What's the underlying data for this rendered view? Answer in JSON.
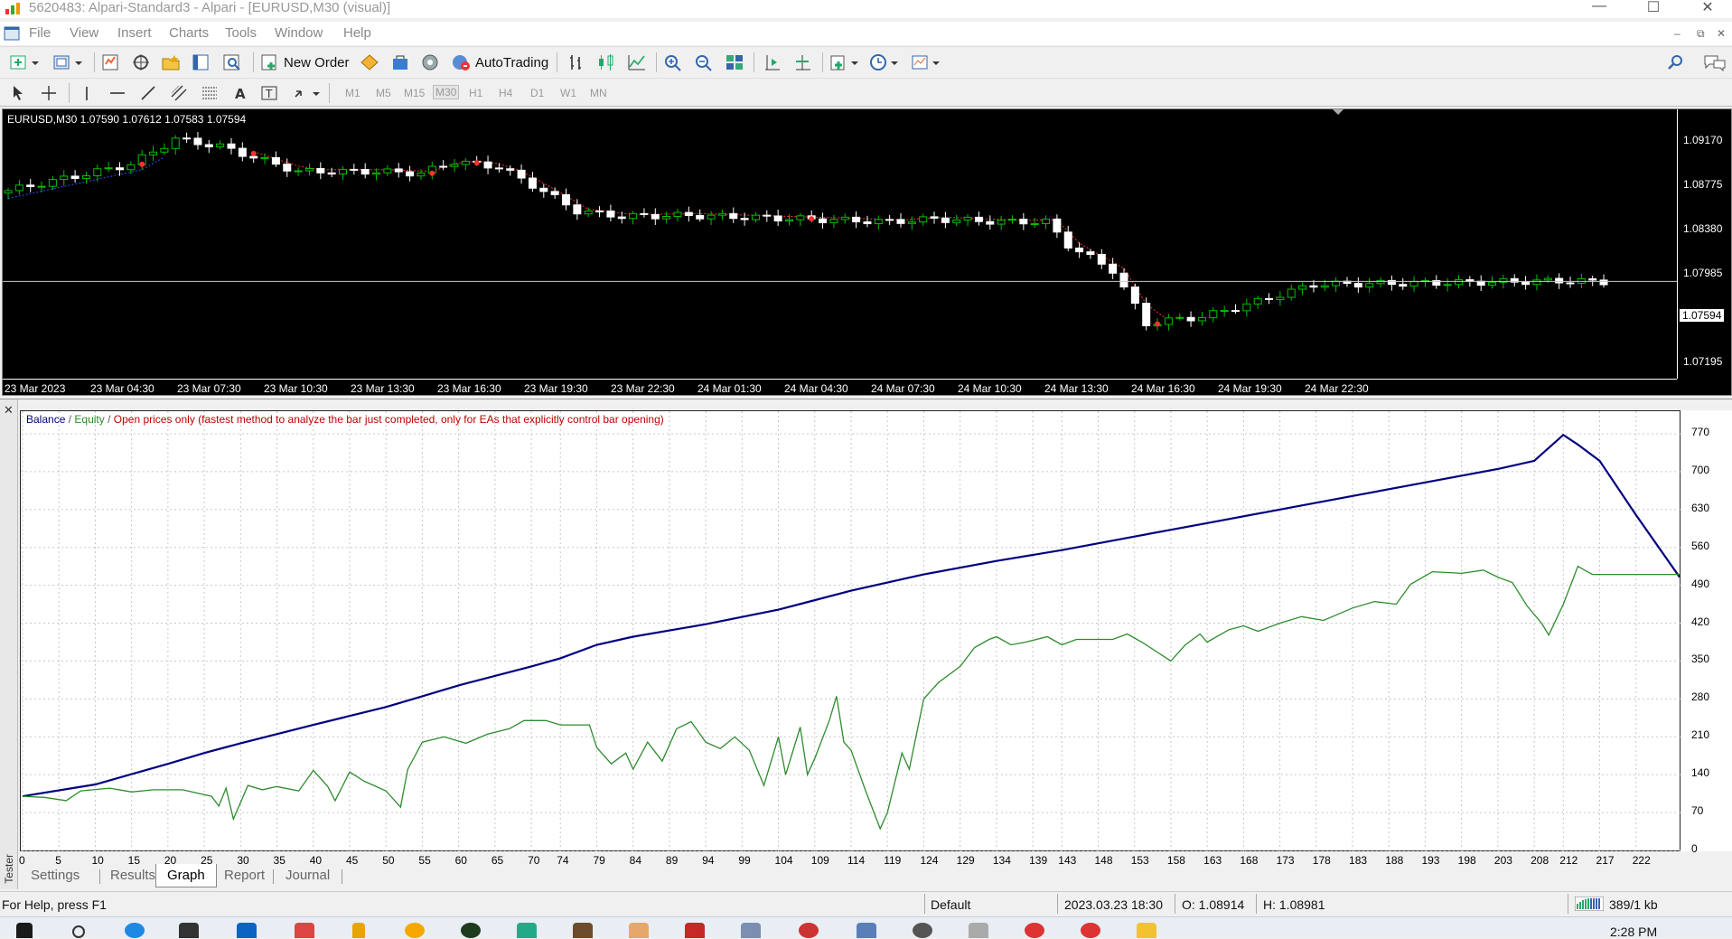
{
  "window": {
    "title": "5620483: Alpari-Standard3 - Alpari - [EURUSD,M30 (visual)]",
    "min": "—",
    "max": "☐",
    "close": "✕"
  },
  "menu": {
    "items": [
      "File",
      "View",
      "Insert",
      "Charts",
      "Tools",
      "Window",
      "Help"
    ],
    "mdi": [
      "–",
      "⧉",
      "✕"
    ]
  },
  "toolbar": {
    "new_order": "New Order",
    "autotrading": "AutoTrading"
  },
  "timeframes": [
    "M1",
    "M5",
    "M15",
    "M30",
    "H1",
    "H4",
    "D1",
    "W1",
    "MN"
  ],
  "active_timeframe": "M30",
  "chart": {
    "symbol_label": "EURUSD,M30  1.07590 1.07612 1.07583 1.07594",
    "prices": [
      "1.09170",
      "1.08775",
      "1.08380",
      "1.07985",
      "1.07195"
    ],
    "current_price": "1.07594",
    "times": [
      "23 Mar 2023",
      "23 Mar 04:30",
      "23 Mar 07:30",
      "23 Mar 10:30",
      "23 Mar 13:30",
      "23 Mar 16:30",
      "23 Mar 19:30",
      "23 Mar 22:30",
      "24 Mar 01:30",
      "24 Mar 04:30",
      "24 Mar 07:30",
      "24 Mar 10:30",
      "24 Mar 13:30",
      "24 Mar 16:30",
      "24 Mar 19:30",
      "24 Mar 22:30"
    ],
    "colors": {
      "bull": "#00c000",
      "bear": "#ffffff",
      "background": "#000000"
    }
  },
  "tester": {
    "side_label": "Tester",
    "legend": {
      "balance": "Balance",
      "equity": "Equity",
      "mode": "Open prices only (fastest method to analyze the bar just completed, only for EAs that explicitly control bar opening)"
    },
    "tabs": [
      "Settings",
      "Results",
      "Graph",
      "Report",
      "Journal"
    ],
    "active_tab": "Graph"
  },
  "chart_data": {
    "type": "line",
    "xlabel": "",
    "ylabel": "",
    "x_ticks": [
      0,
      5,
      10,
      15,
      20,
      25,
      30,
      35,
      40,
      45,
      50,
      55,
      60,
      65,
      70,
      74,
      79,
      84,
      89,
      94,
      99,
      104,
      109,
      114,
      119,
      124,
      129,
      134,
      139,
      143,
      148,
      153,
      158,
      163,
      168,
      173,
      178,
      183,
      188,
      193,
      198,
      203,
      208,
      212,
      217,
      222
    ],
    "y_ticks": [
      0,
      70,
      140,
      210,
      280,
      350,
      420,
      490,
      560,
      630,
      700,
      770
    ],
    "ylim": [
      0,
      805
    ],
    "grid": true,
    "series": [
      {
        "name": "Balance",
        "color": "#00007f",
        "points": [
          [
            0,
            100
          ],
          [
            10,
            122
          ],
          [
            20,
            160
          ],
          [
            25,
            180
          ],
          [
            30,
            198
          ],
          [
            40,
            232
          ],
          [
            50,
            265
          ],
          [
            55,
            285
          ],
          [
            60,
            305
          ],
          [
            70,
            340
          ],
          [
            74,
            355
          ],
          [
            79,
            380
          ],
          [
            84,
            395
          ],
          [
            94,
            418
          ],
          [
            104,
            445
          ],
          [
            114,
            480
          ],
          [
            124,
            510
          ],
          [
            134,
            535
          ],
          [
            143,
            555
          ],
          [
            153,
            580
          ],
          [
            163,
            605
          ],
          [
            173,
            630
          ],
          [
            183,
            655
          ],
          [
            193,
            680
          ],
          [
            203,
            705
          ],
          [
            208,
            720
          ],
          [
            212,
            768
          ],
          [
            214,
            750
          ],
          [
            217,
            720
          ],
          [
            222,
            620
          ],
          [
            228,
            505
          ]
        ]
      },
      {
        "name": "Equity",
        "color": "#2e8b2e",
        "points": [
          [
            0,
            100
          ],
          [
            3,
            98
          ],
          [
            6,
            92
          ],
          [
            8,
            110
          ],
          [
            12,
            115
          ],
          [
            15,
            108
          ],
          [
            18,
            112
          ],
          [
            22,
            112
          ],
          [
            26,
            100
          ],
          [
            27,
            82
          ],
          [
            28,
            115
          ],
          [
            29,
            58
          ],
          [
            31,
            120
          ],
          [
            33,
            112
          ],
          [
            35,
            118
          ],
          [
            38,
            110
          ],
          [
            40,
            148
          ],
          [
            42,
            118
          ],
          [
            43,
            92
          ],
          [
            45,
            145
          ],
          [
            47,
            128
          ],
          [
            50,
            110
          ],
          [
            52,
            80
          ],
          [
            53,
            150
          ],
          [
            55,
            200
          ],
          [
            58,
            210
          ],
          [
            61,
            198
          ],
          [
            64,
            215
          ],
          [
            67,
            225
          ],
          [
            69,
            240
          ],
          [
            72,
            240
          ],
          [
            74,
            232
          ],
          [
            78,
            232
          ],
          [
            79,
            190
          ],
          [
            81,
            160
          ],
          [
            83,
            180
          ],
          [
            84,
            150
          ],
          [
            86,
            200
          ],
          [
            88,
            165
          ],
          [
            90,
            225
          ],
          [
            92,
            238
          ],
          [
            94,
            200
          ],
          [
            96,
            188
          ],
          [
            98,
            210
          ],
          [
            100,
            185
          ],
          [
            102,
            120
          ],
          [
            104,
            210
          ],
          [
            105,
            140
          ],
          [
            107,
            228
          ],
          [
            108,
            140
          ],
          [
            109,
            170
          ],
          [
            111,
            240
          ],
          [
            112,
            285
          ],
          [
            113,
            200
          ],
          [
            114,
            185
          ],
          [
            116,
            110
          ],
          [
            118,
            40
          ],
          [
            119,
            70
          ],
          [
            121,
            180
          ],
          [
            122,
            150
          ],
          [
            124,
            280
          ],
          [
            126,
            310
          ],
          [
            129,
            340
          ],
          [
            131,
            375
          ],
          [
            133,
            390
          ],
          [
            134,
            395
          ],
          [
            136,
            380
          ],
          [
            138,
            385
          ],
          [
            141,
            395
          ],
          [
            143,
            380
          ],
          [
            145,
            390
          ],
          [
            150,
            390
          ],
          [
            152,
            400
          ],
          [
            154,
            385
          ],
          [
            158,
            350
          ],
          [
            160,
            380
          ],
          [
            162,
            400
          ],
          [
            163,
            385
          ],
          [
            166,
            408
          ],
          [
            168,
            415
          ],
          [
            170,
            405
          ],
          [
            173,
            420
          ],
          [
            176,
            432
          ],
          [
            179,
            425
          ],
          [
            183,
            448
          ],
          [
            186,
            460
          ],
          [
            189,
            455
          ],
          [
            191,
            492
          ],
          [
            194,
            515
          ],
          [
            198,
            512
          ],
          [
            201,
            518
          ],
          [
            203,
            505
          ],
          [
            205,
            495
          ],
          [
            207,
            452
          ],
          [
            209,
            420
          ],
          [
            210,
            398
          ],
          [
            212,
            455
          ],
          [
            214,
            525
          ],
          [
            216,
            510
          ],
          [
            228,
            510
          ]
        ]
      }
    ]
  },
  "status": {
    "help": "For Help, press F1",
    "profile": "Default",
    "datetime": "2023.03.23 18:30",
    "open": "O: 1.08914",
    "high": "H: 1.08981",
    "traffic": "389/1 kb"
  },
  "taskbar": {
    "clock": "2:28 PM"
  }
}
